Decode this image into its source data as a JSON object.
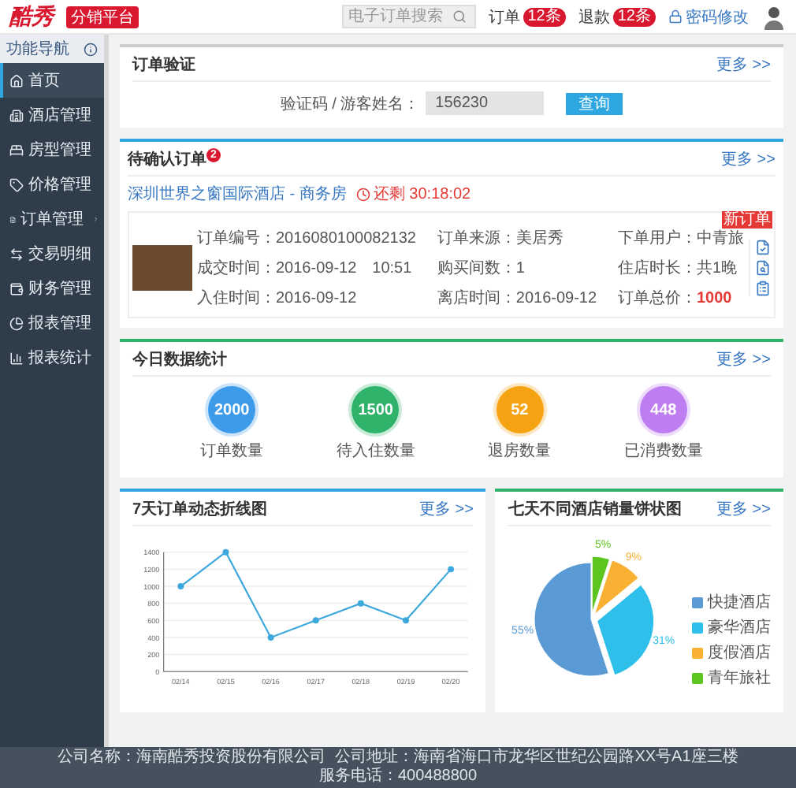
{
  "header": {
    "logo": "酷秀",
    "logo_tag": "分销平台",
    "search": {
      "placeholder": "电子订单搜索"
    },
    "alerts": [
      {
        "label": "订单",
        "badge": "12条"
      },
      {
        "label": "退款",
        "badge": "12条"
      }
    ],
    "account_link": "密码修改"
  },
  "sidebar": {
    "title": "功能导航",
    "items": [
      {
        "label": "首页",
        "selected": true,
        "has_submenu": false
      },
      {
        "label": "酒店管理",
        "selected": false,
        "has_submenu": false
      },
      {
        "label": "房型管理",
        "selected": false,
        "has_submenu": false
      },
      {
        "label": "价格管理",
        "selected": false,
        "has_submenu": false
      },
      {
        "label": "订单管理",
        "selected": false,
        "has_submenu": true
      },
      {
        "label": "交易明细",
        "selected": false,
        "has_submenu": false
      },
      {
        "label": "财务管理",
        "selected": false,
        "has_submenu": false
      },
      {
        "label": "报表管理",
        "selected": false,
        "has_submenu": false
      },
      {
        "label": "报表统计",
        "selected": false,
        "has_submenu": false
      }
    ]
  },
  "verify": {
    "title": "订单验证",
    "more": "更多 >>",
    "label": "验证码 / 游客姓名：",
    "value": "156230",
    "button": "查询"
  },
  "pending": {
    "title": "待确认订单",
    "count": "2",
    "more": "更多 >>",
    "hotel": "深圳世界之窗国际酒店 - 商务房",
    "countdown": "还剩 30:18:02",
    "fields": [
      {
        "text": "订单编号：2016080100082132",
        "highlight": false
      },
      {
        "text": "订单来源：美居秀",
        "highlight": false
      },
      {
        "text": "下单用户：中青旅",
        "highlight": false
      },
      {
        "text": "成交时间：2016-09-12　10:51",
        "highlight": false
      },
      {
        "text": "购买间数：1",
        "highlight": false
      },
      {
        "text": "住店时长：共1晚",
        "highlight": false
      },
      {
        "text": "入住时间：2016-09-12",
        "highlight": false
      },
      {
        "text": "离店时间：2016-09-12",
        "highlight": false
      },
      {
        "label": "订单总价：",
        "text": "1000",
        "highlight": true
      }
    ],
    "badge": "新订单"
  },
  "stats": {
    "title": "今日数据统计",
    "more": "更多 >>",
    "items": [
      {
        "value": "2000",
        "label": "订单数量",
        "color": "#3d9be9"
      },
      {
        "value": "1500",
        "label": "待入住数量",
        "color": "#2fb36a"
      },
      {
        "value": "52",
        "label": "退房数量",
        "color": "#f5a213"
      },
      {
        "value": "448",
        "label": "已消费数量",
        "color": "#bf7df2"
      }
    ]
  },
  "line_panel": {
    "more": "更多 >>",
    "chart_data": {
      "type": "line",
      "title": "7天订单动态折线图",
      "categories": [
        "02/14",
        "02/15",
        "02/16",
        "02/17",
        "02/18",
        "02/19",
        "02/20"
      ],
      "series": [
        {
          "color": "#3ba7dc",
          "marker": "circle",
          "values": [
            1000,
            1400,
            400,
            600,
            800,
            600,
            1200
          ]
        }
      ],
      "ylim": [
        0,
        1400
      ],
      "yticks": [
        0,
        200,
        400,
        600,
        800,
        1000,
        1200,
        1400
      ],
      "grid": true
    }
  },
  "pie_panel": {
    "more": "更多 >>",
    "chart_data": {
      "type": "pie",
      "title": "七天不同酒店销量饼状图",
      "categories": [
        "快捷酒店",
        "豪华酒店",
        "度假酒店",
        "青年旅社"
      ],
      "values": [
        55,
        31,
        9,
        5
      ],
      "value_labels": [
        "55%",
        "31%",
        "9%",
        "5%"
      ]
    },
    "legend": [
      {
        "color": "#5b9bd5"
      },
      {
        "color": "#2ec0eb"
      },
      {
        "color": "#f8b133"
      },
      {
        "color": "#5cc51f"
      }
    ]
  },
  "footer": [
    "公司名称：海南酷秀投资股份有限公司",
    "公司地址：海南省海口市龙华区世纪公园路XX号A1座三楼",
    "服务电话：400488800"
  ]
}
